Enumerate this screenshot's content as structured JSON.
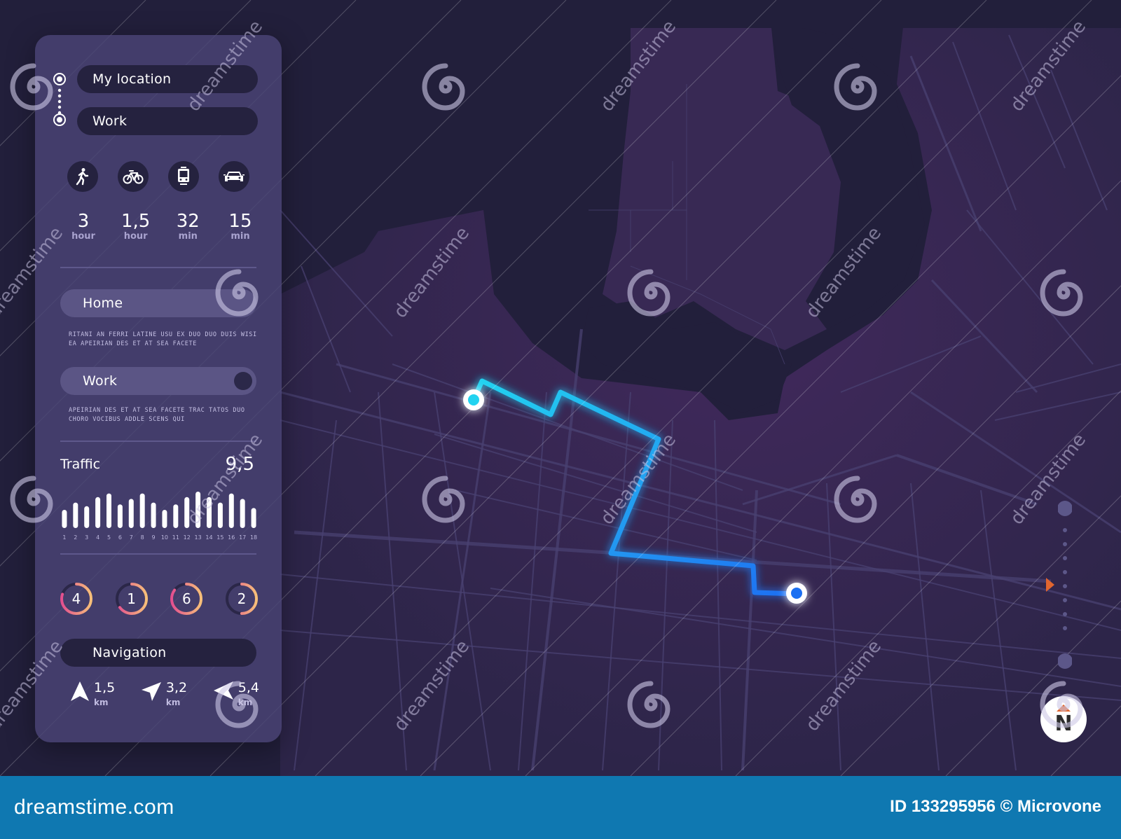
{
  "route": {
    "from": "My location",
    "to": "Work"
  },
  "transport_modes": [
    {
      "icon": "walk-icon",
      "value": "3",
      "unit": "hour"
    },
    {
      "icon": "bicycle-icon",
      "value": "1,5",
      "unit": "hour"
    },
    {
      "icon": "train-icon",
      "value": "32",
      "unit": "min"
    },
    {
      "icon": "car-icon",
      "value": "15",
      "unit": "min"
    }
  ],
  "places": [
    {
      "label": "Home",
      "toggle_on": true,
      "description": "RITANI AN FERRI LATINE USU EX DUO DUO DUIS WISI EA APEIRIAN DES ET AT SEA FACETE"
    },
    {
      "label": "Work",
      "toggle_on": false,
      "description": "APEIRIAN DES ET AT SEA FACETE TRAC TATOS DUO CHORO VOCIBUS ADDLE SCENS QUI"
    }
  ],
  "traffic": {
    "label": "Traffic",
    "value": "9,5"
  },
  "chart_data": {
    "type": "bar",
    "title": "Traffic",
    "categories": [
      "1",
      "2",
      "3",
      "4",
      "5",
      "6",
      "7",
      "8",
      "9",
      "10",
      "11",
      "12",
      "13",
      "14",
      "15",
      "16",
      "17",
      "18"
    ],
    "values": [
      5,
      7,
      6,
      8.5,
      9.5,
      6.5,
      8,
      9.5,
      7,
      5,
      6.5,
      8.5,
      10,
      8.5,
      7,
      9.5,
      8,
      5.5
    ],
    "ylim": [
      0,
      10
    ],
    "xlabel": "",
    "ylabel": "",
    "grid": false
  },
  "indicators": [
    {
      "value": "4",
      "fraction": 0.8
    },
    {
      "value": "1",
      "fraction": 0.65
    },
    {
      "value": "6",
      "fraction": 0.85
    },
    {
      "value": "2",
      "fraction": 0.5
    }
  ],
  "navigation": {
    "label": "Navigation",
    "steps": [
      {
        "icon": "arrow-up-icon",
        "value": "1,5",
        "unit": "km"
      },
      {
        "icon": "arrow-turn-right-icon",
        "value": "3,2",
        "unit": "km"
      },
      {
        "icon": "arrow-left-icon",
        "value": "5,4",
        "unit": "km"
      }
    ]
  },
  "compass": {
    "label": "N"
  },
  "colors": {
    "background": "#22203b",
    "land": "#3a2a55",
    "route_start": "#22d3f0",
    "route_end": "#1f6ff2",
    "gauge_start": "#e34f8f",
    "gauge_end": "#f7c07a",
    "accent_orange": "#e0652f",
    "footer": "#0f78b1"
  },
  "footer": {
    "logo": "dreamstime.com",
    "credit": "ID 133295956 © Microvone"
  },
  "watermark": "dreamstime"
}
